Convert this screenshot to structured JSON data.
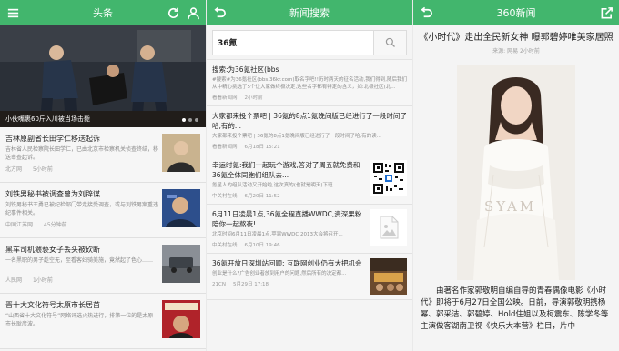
{
  "screen1": {
    "title": "头条",
    "hero_caption": "小伙嘴裹60斤入川被当场击毙",
    "news": [
      {
        "title": "吉林原副省长田学仁移送起诉",
        "desc": "吉林省人民检察院长田学仁，已由北京市检察机关侦查终结，移送审查起诉。",
        "source": "北方网",
        "time": "5小时前"
      },
      {
        "title": "刘铁男秘书被调查曾为刘辟谋",
        "desc": "刘铁男秘书王勇已被纪检部门带走接受调查，或与刘铁男案重违纪事件相关。",
        "source": "中国江苏网",
        "time": "45分钟前"
      },
      {
        "title": "黑车司机猥亵女子丢头被砍断",
        "desc": "一名黑职的男子趁空无，至看客妇骑美施，竟然起了色心……",
        "source": "人民网",
        "time": "1小时前"
      },
      {
        "title": "晋十大文化符号太原市长居首",
        "desc": "“山西省十大文化符号”网络评选火热进行，排第一位的是太原市长耿彦波。",
        "source": "",
        "time": ""
      }
    ]
  },
  "screen2": {
    "title": "新闻搜索",
    "query": "36氪",
    "results": [
      {
        "title": "搜索:为36氪社区(bbs",
        "desc": "#搜索#为36氪社区(bbs.36kr.com)取名字吧!!历时两天的征名活动,我们得到,随后我们从中精心挑选了5个让大家做终极决定,这些名字都有特定的含义，如:北极社区(北...",
        "source": "看看新闻网",
        "time": "2小时前",
        "thumb": ""
      },
      {
        "title": "大家都来投个票吧 | 36氪的8点1氪晚间版已经进行了一段时间了哈,有的...",
        "desc": "大家都来投个票吧 | 36氪的8点1氪晚间版已经进行了一段时间了哈,有的读...",
        "source": "看看新闻网",
        "time": "6月18日 15:21",
        "thumb": ""
      },
      {
        "title": "幸运时氪:我们一起玩个游戏,答对了周五就免费和36氪全体同胞们组队去...",
        "desc": "氪星人的组队活动又开始啦,这次真的(也就是明天)下班...",
        "source": "中关村在线",
        "time": "6月20日 11:52",
        "thumb": "qr"
      },
      {
        "title": "6月11日凌晨1点,36氪全程直播WWDC,资深果粉陪你一起熬夜!",
        "desc": "北京时间6月11日凌晨1点,苹果WWDC 2013大会将召开...",
        "source": "中关村在线",
        "time": "6月10日 19:46",
        "thumb": "placeholder"
      },
      {
        "title": "36氪开放日深圳站回顾: 互联网创业仍有大把机会",
        "desc": "创业是什么?广告创业者放到用户的问题,然后所有的决定都...",
        "source": "21CN",
        "time": "5月29日 17:18",
        "thumb": "photo"
      }
    ]
  },
  "screen3": {
    "title": "360新闻",
    "article_title": "《小时代》走出全民新女神 曝郭碧婷唯美家居照",
    "article_meta": "来源: 网易 2小时前",
    "body": "由著名作家郭敬明自编自导的青春偶像电影《小时代》即将于6月27日全国公映。日前，导演郭敬明携杨幂、郭采洁、郭碧婷、Hold住姐以及柯震东、陈学冬等主演做客湖南卫视《快乐大本营》栏目，片中",
    "photo_mark": "SYAM"
  },
  "colors": {
    "accent": "#42b66d"
  }
}
